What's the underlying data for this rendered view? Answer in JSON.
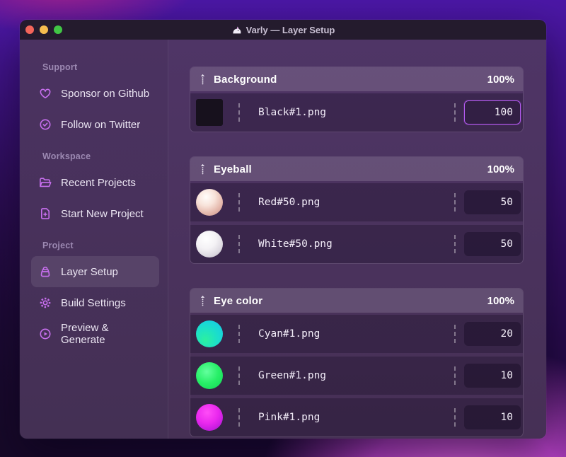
{
  "window": {
    "title": "Varly — Layer Setup",
    "app_icon": "unicorn-icon",
    "traffic_lights": [
      {
        "name": "close",
        "color": "#f3655a"
      },
      {
        "name": "minimize",
        "color": "#f5bd4f"
      },
      {
        "name": "zoom",
        "color": "#41c645"
      }
    ]
  },
  "colors": {
    "accent": "#c76fee",
    "focus_border": "#b55bf2",
    "sidebar_bg": "#4b3261",
    "main_bg": "#4f3566",
    "titlebar_bg": "#241b2d"
  },
  "sidebar": {
    "sections": [
      {
        "label": "Support",
        "items": [
          {
            "label": "Sponsor on Github",
            "icon": "heart",
            "active": false
          },
          {
            "label": "Follow on Twitter",
            "icon": "badge-check",
            "active": false
          }
        ]
      },
      {
        "label": "Workspace",
        "items": [
          {
            "label": "Recent Projects",
            "icon": "folder-open",
            "active": false
          },
          {
            "label": "Start New Project",
            "icon": "file-plus",
            "active": false
          }
        ]
      },
      {
        "label": "Project",
        "items": [
          {
            "label": "Layer Setup",
            "icon": "layer-bag",
            "active": true
          },
          {
            "label": "Build Settings",
            "icon": "gear",
            "active": false
          },
          {
            "label": "Preview & Generate",
            "icon": "play-circle",
            "active": false
          }
        ]
      }
    ]
  },
  "layers": {
    "groups": [
      {
        "name": "Background",
        "weight": "100%",
        "drag_icon": "drag-handle",
        "items": [
          {
            "file": "Black#1.png",
            "value": "100",
            "thumb": "black-square",
            "focused": true
          }
        ]
      },
      {
        "name": "Eyeball",
        "weight": "100%",
        "drag_icon": "drag-handle",
        "items": [
          {
            "file": "Red#50.png",
            "value": "50",
            "thumb": "red-sphere",
            "focused": false
          },
          {
            "file": "White#50.png",
            "value": "50",
            "thumb": "white-sphere",
            "focused": false
          }
        ]
      },
      {
        "name": "Eye color",
        "weight": "100%",
        "drag_icon": "drag-handle",
        "items": [
          {
            "file": "Cyan#1.png",
            "value": "20",
            "thumb": "cyan-circle",
            "focused": false
          },
          {
            "file": "Green#1.png",
            "value": "10",
            "thumb": "green-circle",
            "focused": false
          },
          {
            "file": "Pink#1.png",
            "value": "10",
            "thumb": "pink-circle",
            "focused": false
          }
        ]
      }
    ]
  }
}
